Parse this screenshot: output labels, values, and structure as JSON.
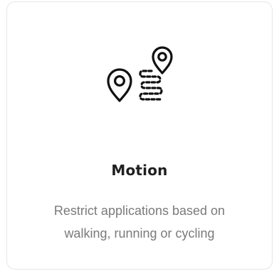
{
  "card": {
    "icon": "motion-route-pins-icon",
    "title": "Motion",
    "description_line1": "Restrict applications based on",
    "description_line2": "walking, running or cycling"
  },
  "colors": {
    "card_border": "#e6e6e6",
    "title": "#1f1f1f",
    "description": "#7a7a7a",
    "icon_stroke": "#111111"
  }
}
